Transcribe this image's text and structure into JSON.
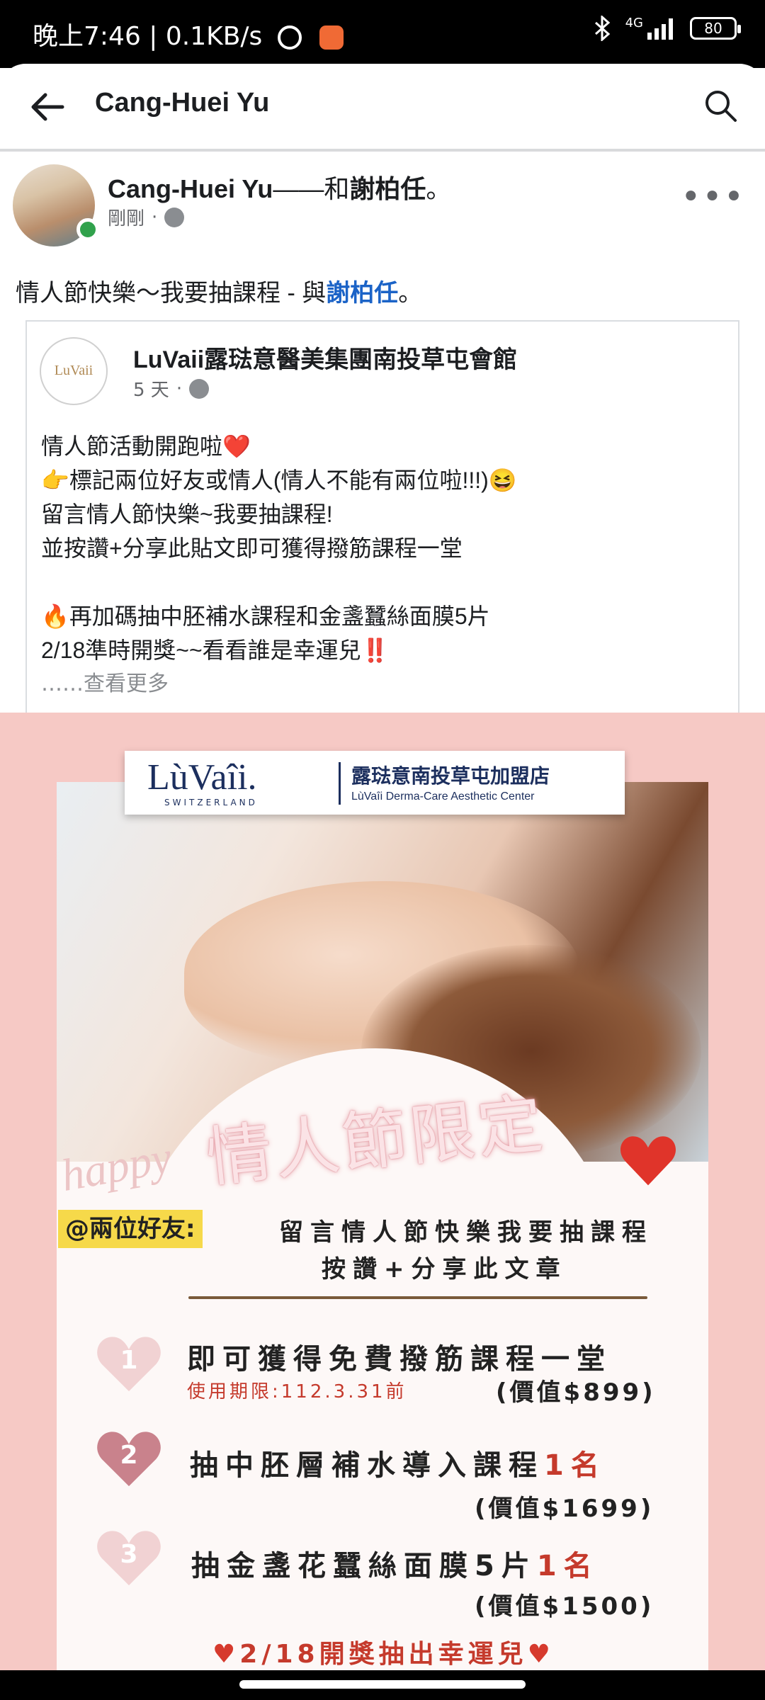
{
  "status_bar": {
    "time_speed": "晚上7:46 | 0.1KB/s",
    "network": "4G",
    "battery": "80"
  },
  "header": {
    "title": "Cang-Huei Yu"
  },
  "post": {
    "author": "Cang-Huei Yu",
    "with_text": "——和",
    "tagged": "謝柏任",
    "end_mark": "。",
    "time": "剛剛",
    "dot": "·",
    "caption_text": "情人節快樂～我要抽課程 - 與",
    "caption_link": "謝柏任",
    "caption_end": "。"
  },
  "shared": {
    "page_name": "LuVaii露琺意醫美集團南投草屯會館",
    "logo_text": "LuVaii",
    "time": "5 天",
    "dot": "·",
    "body": "情人節活動開跑啦❤️\n👉標記兩位好友或情人(情人不能有兩位啦!!!)😆\n留言情人節快樂~我要抽課程!\n並按讚+分享此貼文即可獲得撥筋課程一堂\n\n🔥再加碼抽中胚補水課程和金盞蠶絲面膜5片\n2/18準時開獎~~看看誰是幸運兒‼️",
    "see_more": "……查看更多"
  },
  "promo": {
    "logo_main": "LùVaîi.",
    "logo_sub": "SWITZERLAND",
    "logo_title": "露琺意南投草屯加盟店",
    "logo_subtitle": "LùVaîi  Derma-Care Aesthetic Center",
    "headline": "情人節限定",
    "happy": "happy",
    "tag": "@兩位好友:",
    "line1": "留言情人節快樂我要抽課程",
    "line2": "按讚+分享此文章",
    "items": [
      {
        "num": "1",
        "text": "即可獲得免費撥筋課程一堂",
        "red": "",
        "sub": "使用期限:112.3.31前",
        "value": "(價值$899)"
      },
      {
        "num": "2",
        "text": "抽中胚層補水導入課程",
        "red": "1名",
        "sub": "",
        "value": "(價值$1699)"
      },
      {
        "num": "3",
        "text": "抽金盞花蠶絲面膜5片",
        "red": "1名",
        "sub": "",
        "value": "(價值$1500)"
      }
    ],
    "draw": "2/18開獎抽出幸運兒",
    "heart": "♥"
  },
  "colors": {
    "link": "#1b63c7",
    "online": "#31a24c",
    "promo_bg": "#f6c9c5",
    "accent_red": "#c53a2c"
  }
}
